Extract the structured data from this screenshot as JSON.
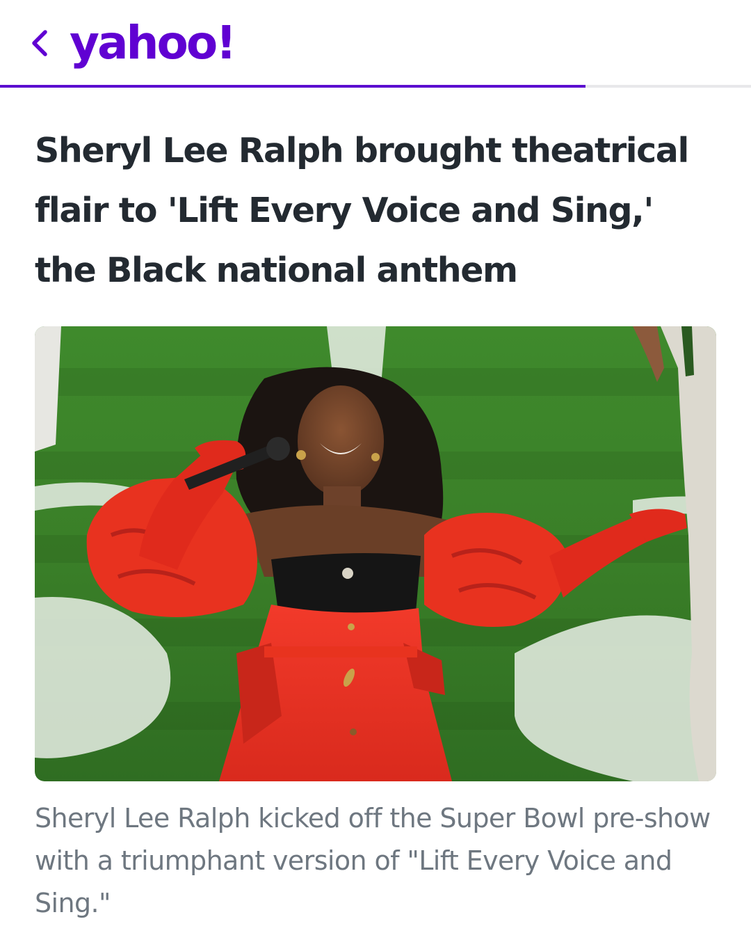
{
  "header": {
    "back_icon": "chevron-left-icon",
    "logo_text": "yahoo!",
    "brand_color": "#6001d2",
    "read_progress_percent": 78
  },
  "article": {
    "headline": "Sheryl Lee Ralph brought theatrical flair to 'Lift Every Voice and Sing,' the Black national anthem",
    "image": {
      "subject": "Sheryl Lee Ralph singing into a microphone in a red dress on a football field"
    },
    "caption": "Sheryl Lee Ralph kicked off the Super Bowl pre-show with a triumphant version of \"Lift Every Voice and Sing.\""
  }
}
